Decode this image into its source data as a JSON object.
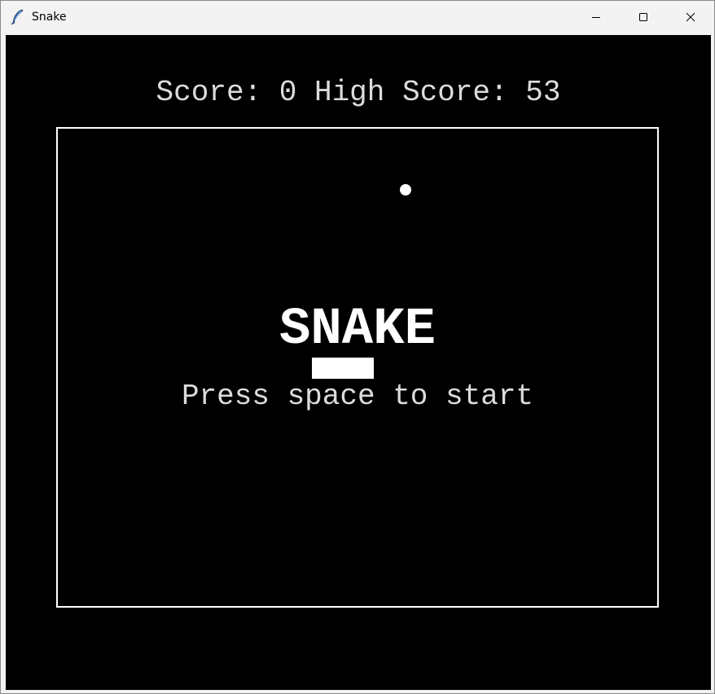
{
  "window": {
    "title": "Snake",
    "app_icon": "feather-icon",
    "controls": {
      "minimize_icon": "minimize-icon",
      "maximize_icon": "maximize-icon",
      "close_icon": "close-icon"
    }
  },
  "game": {
    "score_text": "Score: 0 High Score: 53",
    "title": "SNAKE",
    "start_prompt": "Press space to start",
    "colors": {
      "background": "#000000",
      "foreground": "#ffffff",
      "text": "#dcdcdc"
    }
  }
}
